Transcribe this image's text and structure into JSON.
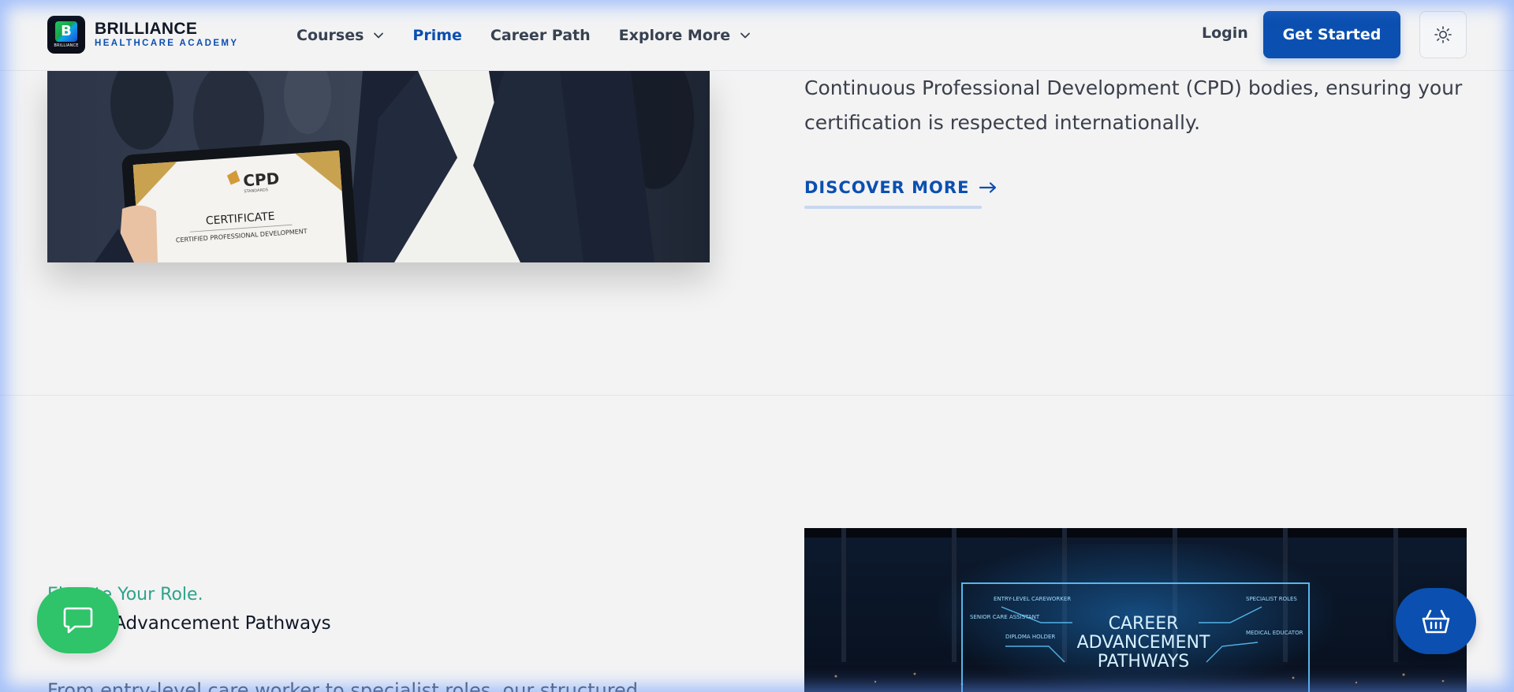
{
  "brand": {
    "title": "BRILLIANCE",
    "subtitle": "HEALTHCARE ACADEMY",
    "mark_letter": "B",
    "mark_caption": "BRILLIANCE"
  },
  "nav": {
    "items": [
      {
        "label": "Courses",
        "has_dropdown": true,
        "active": false
      },
      {
        "label": "Prime",
        "has_dropdown": false,
        "active": true
      },
      {
        "label": "Career Path",
        "has_dropdown": false,
        "active": false
      },
      {
        "label": "Explore More",
        "has_dropdown": true,
        "active": false
      }
    ],
    "login_label": "Login",
    "cta_label": "Get Started",
    "theme_toggle_icon": "sun-icon"
  },
  "section_cpd": {
    "image": {
      "badge_text": "CPD",
      "badge_sub": "STANDARDS",
      "certificate_title": "CERTIFICATE",
      "certificate_sub": "CERTIFIED PROFESSIONAL DEVELOPMENT"
    },
    "body": "Continuous Professional Development (CPD) bodies, ensuring your certification is respected internationally.",
    "link_label": "DISCOVER MORE",
    "link_icon": "arrow-right-icon"
  },
  "section_career": {
    "eyebrow": "Elevate Your Role.",
    "title": "Career Advancement Pathways",
    "paragraph_start": "From entry-level care worker to specialist roles, our structured",
    "image": {
      "headline_1": "CAREER",
      "headline_2": "ADVANCEMENT",
      "headline_3": "PATHWAYS",
      "labels": [
        "ENTRY-LEVEL CAREWORKER",
        "SPECIALIST ROLES",
        "SENIOR CARE ASSISTANT",
        "DIPLOMA HOLDER",
        "MEDICAL EDUCATOR"
      ]
    }
  },
  "floating": {
    "chat_icon": "chat-bubble-icon",
    "cart_icon": "basket-icon"
  },
  "colors": {
    "brand_blue": "#0b4fb0",
    "accent_green": "#2ea38a",
    "chat_green": "#2fc36a",
    "background": "#f3f3f4"
  }
}
